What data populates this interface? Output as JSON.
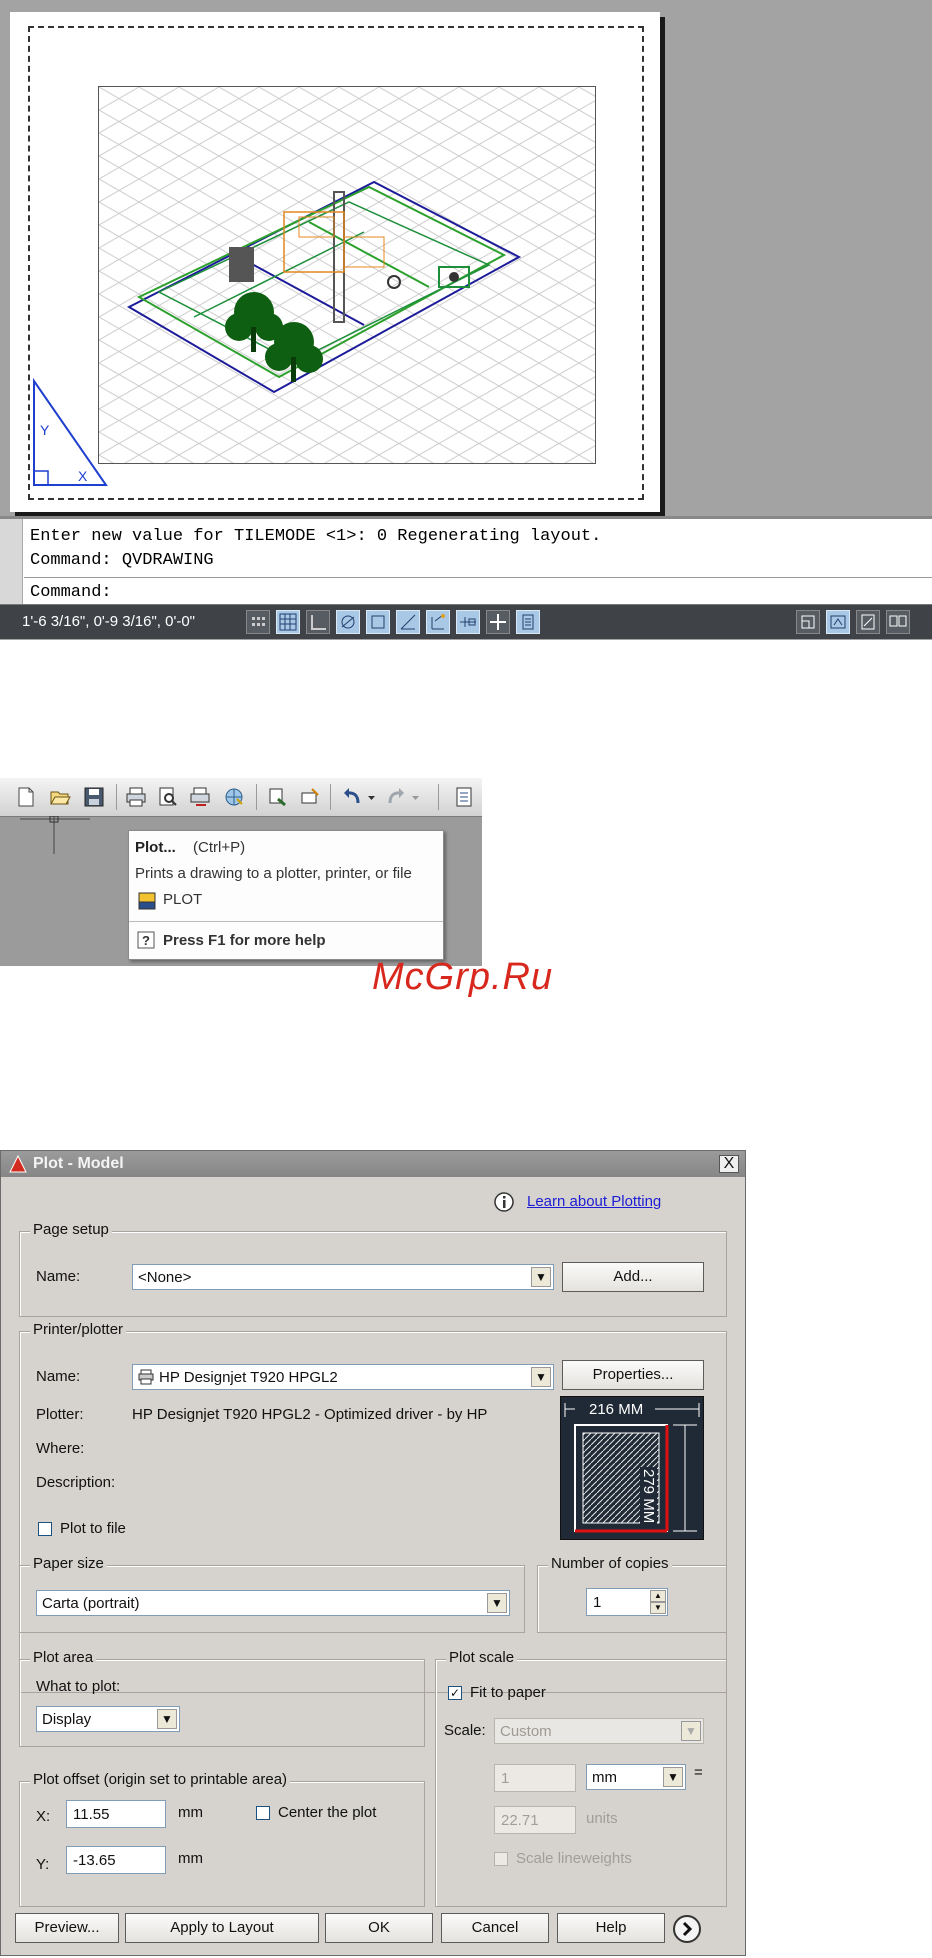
{
  "cad": {
    "command_lines": [
      "Enter new value for TILEMODE <1>: 0 Regenerating layout.",
      "Command: QVDRAWING",
      "Command:"
    ],
    "coordinates": "1'-6 3/16\", 0'-9 3/16\", 0'-0\"",
    "ucs_labels": {
      "y": "Y",
      "x": "X"
    }
  },
  "toolbar_tooltip": {
    "title": "Plot...",
    "shortcut": "(Ctrl+P)",
    "description": "Prints a drawing to a plotter, printer, or file",
    "command": "PLOT",
    "help": "Press F1 for more help"
  },
  "watermark": "McGrp.Ru",
  "plot_dialog": {
    "title": "Plot - Model",
    "close_label": "X",
    "learn_link": "Learn about Plotting",
    "page_setup": {
      "legend": "Page setup",
      "name_label": "Name:",
      "name_value": "<None>",
      "add_button": "Add..."
    },
    "printer": {
      "legend": "Printer/plotter",
      "name_label": "Name:",
      "name_value": "HP Designjet T920 HPGL2",
      "properties_button": "Properties...",
      "plotter_label": "Plotter:",
      "plotter_value": "HP Designjet T920 HPGL2 - Optimized driver - by HP",
      "where_label": "Where:",
      "description_label": "Description:",
      "plot_to_file_label": "Plot to file",
      "preview_width": "216 MM",
      "preview_height": "279 MM"
    },
    "paper_size": {
      "legend": "Paper size",
      "value": "Carta (portrait)"
    },
    "copies": {
      "legend": "Number of copies",
      "value": "1"
    },
    "plot_area": {
      "legend": "Plot area",
      "what_label": "What to plot:",
      "what_value": "Display"
    },
    "plot_offset": {
      "legend": "Plot offset (origin set to printable area)",
      "x_label": "X:",
      "x_value": "11.55",
      "x_unit": "mm",
      "y_label": "Y:",
      "y_value": "-13.65",
      "y_unit": "mm",
      "center_label": "Center the plot"
    },
    "plot_scale": {
      "legend": "Plot scale",
      "fit_label": "Fit to paper",
      "fit_checked": true,
      "scale_label": "Scale:",
      "scale_value": "Custom",
      "value1": "1",
      "unit_value": "mm",
      "equals": "=",
      "value2": "22.71",
      "units_label": "units",
      "lineweights_label": "Scale lineweights"
    },
    "buttons": {
      "preview": "Preview...",
      "apply": "Apply to Layout",
      "ok": "OK",
      "cancel": "Cancel",
      "help": "Help"
    }
  }
}
